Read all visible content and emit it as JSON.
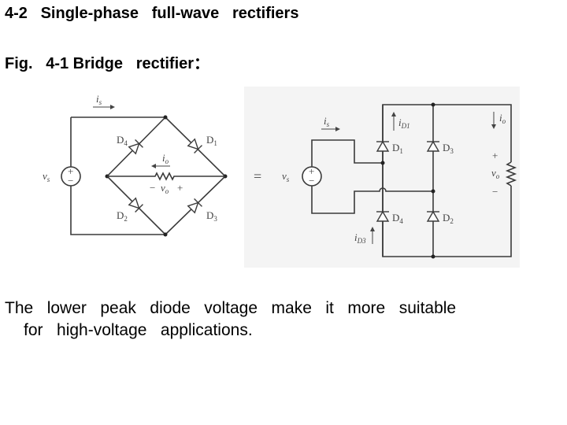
{
  "slide": {
    "title": "4-2   Single-phase   full-wave   rectifiers",
    "figure_caption": "Fig.   4-1 Bridge   rectifier：",
    "paragraph": {
      "line1": "The   lower   peak   diode   voltage   make   it   more   suitable",
      "line2": "for   high-voltage   applications."
    }
  },
  "figure": {
    "left_circuit": {
      "source_label": "v",
      "source_sub": "s",
      "source_plus": "+",
      "source_minus": "−",
      "current_in_label": "i",
      "current_in_sub": "s",
      "diodes": [
        {
          "label": "D",
          "sub": "4"
        },
        {
          "label": "D",
          "sub": "1"
        },
        {
          "label": "D",
          "sub": "2"
        },
        {
          "label": "D",
          "sub": "3"
        }
      ],
      "load_current_label": "i",
      "load_current_sub": "o",
      "load_voltage_minus": "−",
      "load_voltage_label": "v",
      "load_voltage_sub": "o",
      "load_voltage_plus": "+"
    },
    "equals_sign": "=",
    "right_circuit": {
      "source_label": "v",
      "source_sub": "s",
      "source_plus": "+",
      "source_minus": "−",
      "current_in_label": "i",
      "current_in_sub": "s",
      "diodes": [
        {
          "label": "D",
          "sub": "1"
        },
        {
          "label": "D",
          "sub": "3"
        },
        {
          "label": "D",
          "sub": "4"
        },
        {
          "label": "D",
          "sub": "2"
        }
      ],
      "diode_current_top_label": "i",
      "diode_current_top_sub": "D1",
      "diode_current_bottom_label": "i",
      "diode_current_bottom_sub": "D3",
      "load_current_label": "i",
      "load_current_sub": "o",
      "load_voltage_plus": "+",
      "load_voltage_label": "v",
      "load_voltage_sub": "o",
      "load_voltage_minus": "−"
    }
  }
}
